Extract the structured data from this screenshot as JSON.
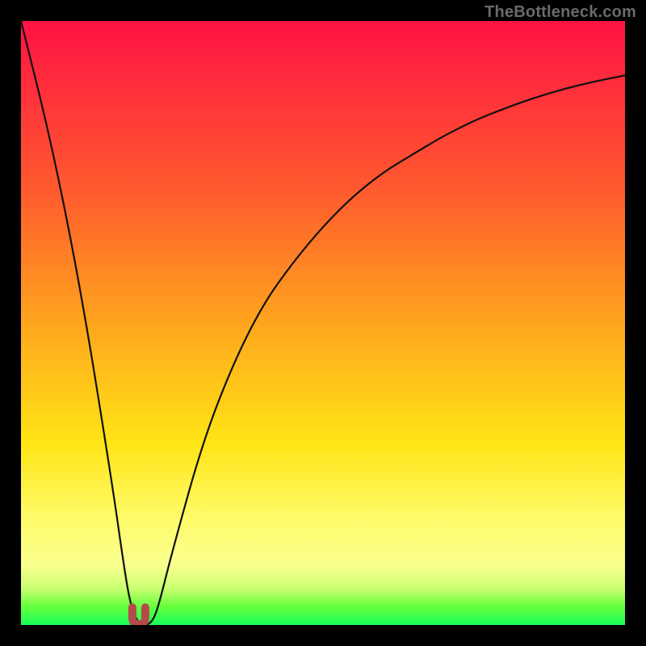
{
  "attribution": "TheBottleneck.com",
  "chart_data": {
    "type": "line",
    "title": "",
    "xlabel": "",
    "ylabel": "",
    "xlim": [
      0,
      100
    ],
    "ylim": [
      0,
      100
    ],
    "grid": false,
    "series": [
      {
        "name": "curve",
        "x": [
          0,
          5,
          10,
          15,
          17,
          18,
          19,
          20,
          21,
          22,
          23,
          25,
          30,
          35,
          40,
          45,
          50,
          55,
          60,
          65,
          70,
          75,
          80,
          85,
          90,
          95,
          100
        ],
        "values": [
          100,
          80,
          55,
          24,
          10,
          4,
          1,
          0,
          0,
          1,
          4,
          12,
          30,
          43,
          53,
          60,
          66,
          71,
          75,
          78,
          81,
          83.5,
          85.5,
          87.3,
          88.8,
          90,
          91
        ]
      }
    ],
    "annotations": [
      {
        "name": "min-marker",
        "x": 19.5,
        "y": 1.2,
        "color": "#b44a4a"
      }
    ],
    "background_gradient": {
      "direction": "vertical",
      "stops": [
        {
          "pos": 0,
          "color": "#ff1244"
        },
        {
          "pos": 50,
          "color": "#ffa51d"
        },
        {
          "pos": 82,
          "color": "#fffb68"
        },
        {
          "pos": 97,
          "color": "#64ff3c"
        },
        {
          "pos": 100,
          "color": "#18ff59"
        }
      ]
    }
  }
}
